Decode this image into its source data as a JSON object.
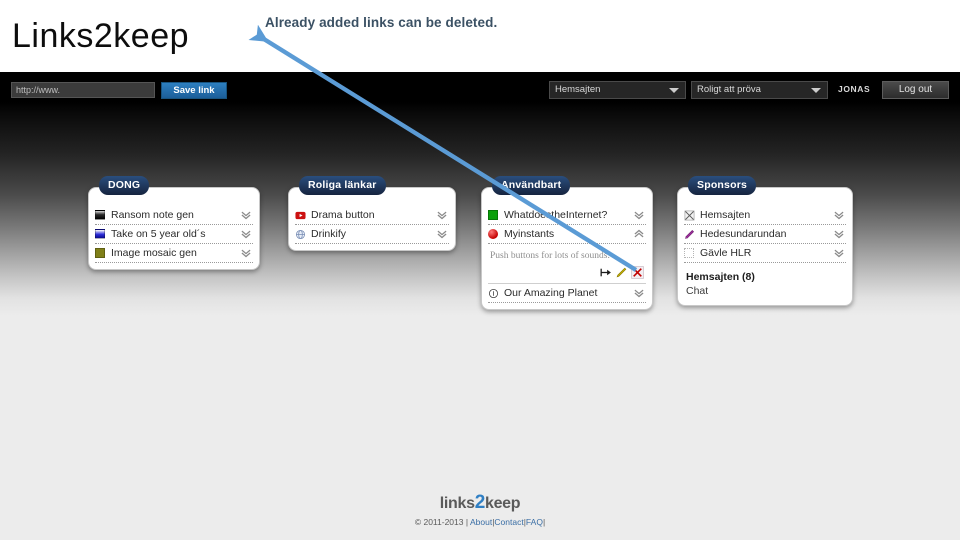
{
  "slide": {
    "brand_title": "Links2keep",
    "annotation": "Already added links can be deleted.",
    "arrow_color": "#5b9bd5"
  },
  "topbar": {
    "url_placeholder": "http://www.",
    "url_value": "",
    "save_label": "Save link",
    "site_select": "Hemsajten",
    "category_select": "Roligt att pröva",
    "username": "JONAS",
    "logout_label": "Log out"
  },
  "cards": [
    {
      "title": "DONG",
      "items": [
        {
          "label": "Ransom note gen",
          "icon": "favicon-dark",
          "state": "collapsed"
        },
        {
          "label": "Take on 5 year old´s",
          "icon": "favicon-blue",
          "state": "collapsed"
        },
        {
          "label": "Image mosaic gen",
          "icon": "favicon-olive",
          "state": "collapsed"
        }
      ]
    },
    {
      "title": "Roliga länkar",
      "items": [
        {
          "label": "Drama button",
          "icon": "youtube-icon",
          "state": "collapsed"
        },
        {
          "label": "Drinkify",
          "icon": "globe-icon",
          "state": "collapsed"
        }
      ]
    },
    {
      "title": "Användbart",
      "items": [
        {
          "label": "WhatdoestheInternet?",
          "icon": "favicon-green",
          "state": "collapsed"
        },
        {
          "label": "Myinstants",
          "icon": "favicon-red-circle",
          "state": "expanded",
          "detail": "Push buttons for lots of sounds.",
          "actions": [
            "move-icon",
            "edit-pencil-icon",
            "delete-x-icon"
          ]
        },
        {
          "label": "Our Amazing Planet",
          "icon": "info-icon",
          "state": "collapsed"
        }
      ]
    },
    {
      "title": "Sponsors",
      "items": [
        {
          "label": "Hemsajten",
          "icon": "x-mark-icon",
          "state": "collapsed"
        },
        {
          "label": "Hedesundarundan",
          "icon": "pen-icon",
          "state": "collapsed"
        },
        {
          "label": "Gävle HLR",
          "icon": "favicon-empty",
          "state": "collapsed"
        }
      ],
      "promo_title": "Hemsajten (8)",
      "promo_sub": "Chat"
    }
  ],
  "footer": {
    "logo_left": "links",
    "logo_two": "2",
    "logo_right": "keep",
    "copyright": "© 2011-2013 |",
    "links": [
      "About",
      "Contact",
      "FAQ"
    ],
    "separator": "|"
  }
}
